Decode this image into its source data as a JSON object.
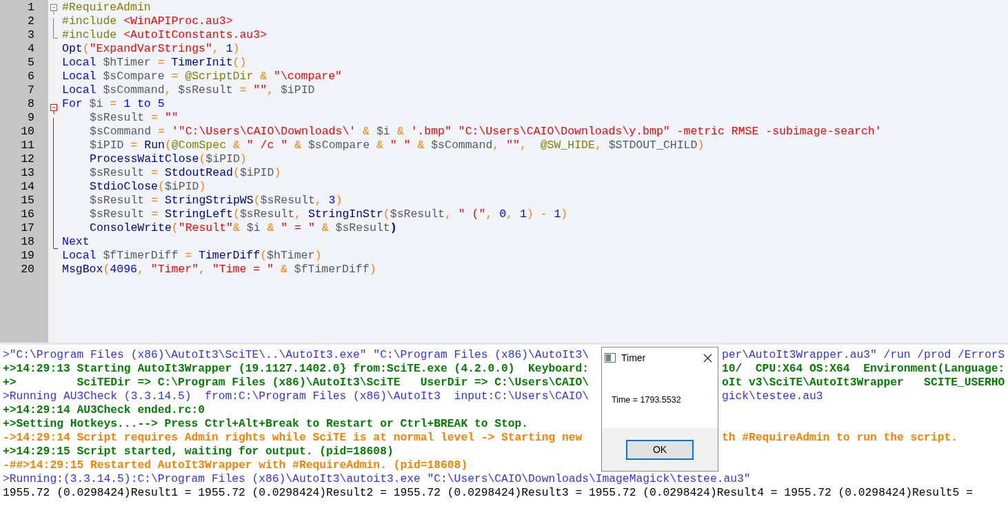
{
  "editor": {
    "lines": [
      {
        "number": "1",
        "kind": "fold-start",
        "fold_highlight": false,
        "indented": false,
        "tokens": [
          {
            "t": "#RequireAdmin",
            "kind": "dir"
          }
        ]
      },
      {
        "number": "2",
        "kind": "fold-mid",
        "fold_highlight": false,
        "indented": false,
        "tokens": [
          {
            "t": "#include ",
            "kind": "dir"
          },
          {
            "t": "<WinAPIProc.au3>",
            "kind": "str"
          }
        ]
      },
      {
        "number": "3",
        "kind": "fold-end",
        "fold_highlight": false,
        "indented": false,
        "tokens": [
          {
            "t": "#include ",
            "kind": "dir"
          },
          {
            "t": "<AutoItConstants.au3>",
            "kind": "str"
          }
        ]
      },
      {
        "number": "4",
        "indented": false,
        "tokens": [
          {
            "t": "Opt",
            "kind": "fn"
          },
          {
            "t": "(",
            "kind": "op"
          },
          {
            "t": "\"ExpandVarStrings\"",
            "kind": "str"
          },
          {
            "t": ", ",
            "kind": "op"
          },
          {
            "t": "1",
            "kind": "num"
          },
          {
            "t": ")",
            "kind": "op"
          }
        ]
      },
      {
        "number": "5",
        "indented": false,
        "tokens": [
          {
            "t": "Local ",
            "kind": "kw"
          },
          {
            "t": "$hTimer ",
            "kind": "var"
          },
          {
            "t": "= ",
            "kind": "op"
          },
          {
            "t": "TimerInit",
            "kind": "fn"
          },
          {
            "t": "()",
            "kind": "op"
          }
        ]
      },
      {
        "number": "6",
        "indented": false,
        "tokens": [
          {
            "t": "Local ",
            "kind": "kw"
          },
          {
            "t": "$sCompare ",
            "kind": "var"
          },
          {
            "t": "= ",
            "kind": "op"
          },
          {
            "t": "@ScriptDir ",
            "kind": "macro"
          },
          {
            "t": "& ",
            "kind": "op"
          },
          {
            "t": "\"\\compare\"",
            "kind": "str"
          }
        ]
      },
      {
        "number": "7",
        "indented": false,
        "tokens": [
          {
            "t": "Local ",
            "kind": "kw"
          },
          {
            "t": "$sCommand",
            "kind": "var"
          },
          {
            "t": ", ",
            "kind": "op"
          },
          {
            "t": "$sResult ",
            "kind": "var"
          },
          {
            "t": "= ",
            "kind": "op"
          },
          {
            "t": "\"\"",
            "kind": "str"
          },
          {
            "t": ", ",
            "kind": "op"
          },
          {
            "t": "$iPID",
            "kind": "var"
          }
        ]
      },
      {
        "number": "8",
        "kind": "fold-start",
        "fold_highlight": true,
        "indented": false,
        "tokens": [
          {
            "t": "For ",
            "kind": "kw"
          },
          {
            "t": "$i ",
            "kind": "var"
          },
          {
            "t": "= ",
            "kind": "op"
          },
          {
            "t": "1 ",
            "kind": "num"
          },
          {
            "t": "to ",
            "kind": "kw"
          },
          {
            "t": "5",
            "kind": "num"
          }
        ]
      },
      {
        "number": "9",
        "kind": "fold-mid",
        "fold_highlight": true,
        "indented": true,
        "tokens": [
          {
            "t": "$sResult ",
            "kind": "var"
          },
          {
            "t": "= ",
            "kind": "op"
          },
          {
            "t": "\"\"",
            "kind": "str"
          }
        ]
      },
      {
        "number": "10",
        "kind": "fold-mid",
        "fold_highlight": true,
        "indented": true,
        "tokens": [
          {
            "t": "$sCommand ",
            "kind": "var"
          },
          {
            "t": "= ",
            "kind": "op"
          },
          {
            "t": "'\"C:\\Users\\CAIO\\Downloads\\'",
            "kind": "str"
          },
          {
            "t": " & ",
            "kind": "op"
          },
          {
            "t": "$i ",
            "kind": "var"
          },
          {
            "t": "& ",
            "kind": "op"
          },
          {
            "t": "'.bmp\" \"C:\\Users\\CAIO\\Downloads\\y.bmp\" -metric RMSE -subimage-search'",
            "kind": "str"
          }
        ]
      },
      {
        "number": "11",
        "kind": "fold-mid",
        "fold_highlight": true,
        "indented": true,
        "tokens": [
          {
            "t": "$iPID ",
            "kind": "var"
          },
          {
            "t": "= ",
            "kind": "op"
          },
          {
            "t": "Run",
            "kind": "fn"
          },
          {
            "t": "(",
            "kind": "op"
          },
          {
            "t": "@ComSpec ",
            "kind": "macro"
          },
          {
            "t": "& ",
            "kind": "op"
          },
          {
            "t": "\" /c \" ",
            "kind": "str"
          },
          {
            "t": "& ",
            "kind": "op"
          },
          {
            "t": "$sCompare ",
            "kind": "var"
          },
          {
            "t": "& ",
            "kind": "op"
          },
          {
            "t": "\" \" ",
            "kind": "str"
          },
          {
            "t": "& ",
            "kind": "op"
          },
          {
            "t": "$sCommand",
            "kind": "var"
          },
          {
            "t": ", ",
            "kind": "op"
          },
          {
            "t": "\"\"",
            "kind": "str"
          },
          {
            "t": ",  ",
            "kind": "op"
          },
          {
            "t": "@SW_HIDE",
            "kind": "macro"
          },
          {
            "t": ", ",
            "kind": "op"
          },
          {
            "t": "$STDOUT_CHILD",
            "kind": "var"
          },
          {
            "t": ")",
            "kind": "op"
          }
        ]
      },
      {
        "number": "12",
        "kind": "fold-mid",
        "fold_highlight": true,
        "indented": true,
        "tokens": [
          {
            "t": "ProcessWaitClose",
            "kind": "fn"
          },
          {
            "t": "(",
            "kind": "op"
          },
          {
            "t": "$iPID",
            "kind": "var"
          },
          {
            "t": ")",
            "kind": "op"
          }
        ]
      },
      {
        "number": "13",
        "kind": "fold-mid",
        "fold_highlight": true,
        "indented": true,
        "tokens": [
          {
            "t": "$sResult ",
            "kind": "var"
          },
          {
            "t": "= ",
            "kind": "op"
          },
          {
            "t": "StdoutRead",
            "kind": "fn"
          },
          {
            "t": "(",
            "kind": "op"
          },
          {
            "t": "$iPID",
            "kind": "var"
          },
          {
            "t": ")",
            "kind": "op"
          }
        ]
      },
      {
        "number": "14",
        "kind": "fold-mid",
        "fold_highlight": true,
        "indented": true,
        "tokens": [
          {
            "t": "StdioClose",
            "kind": "fn"
          },
          {
            "t": "(",
            "kind": "op"
          },
          {
            "t": "$iPID",
            "kind": "var"
          },
          {
            "t": ")",
            "kind": "op"
          }
        ]
      },
      {
        "number": "15",
        "kind": "fold-mid",
        "fold_highlight": true,
        "indented": true,
        "tokens": [
          {
            "t": "$sResult ",
            "kind": "var"
          },
          {
            "t": "= ",
            "kind": "op"
          },
          {
            "t": "StringStripWS",
            "kind": "fn"
          },
          {
            "t": "(",
            "kind": "op"
          },
          {
            "t": "$sResult",
            "kind": "var"
          },
          {
            "t": ", ",
            "kind": "op"
          },
          {
            "t": "3",
            "kind": "num"
          },
          {
            "t": ")",
            "kind": "op"
          }
        ]
      },
      {
        "number": "16",
        "kind": "fold-mid",
        "fold_highlight": true,
        "indented": true,
        "tokens": [
          {
            "t": "$sResult ",
            "kind": "var"
          },
          {
            "t": "= ",
            "kind": "op"
          },
          {
            "t": "StringLeft",
            "kind": "fn"
          },
          {
            "t": "(",
            "kind": "op"
          },
          {
            "t": "$sResult",
            "kind": "var"
          },
          {
            "t": ", ",
            "kind": "op"
          },
          {
            "t": "StringInStr",
            "kind": "fn"
          },
          {
            "t": "(",
            "kind": "op"
          },
          {
            "t": "$sResult",
            "kind": "var"
          },
          {
            "t": ", ",
            "kind": "op"
          },
          {
            "t": "\" (\"",
            "kind": "str"
          },
          {
            "t": ", ",
            "kind": "op"
          },
          {
            "t": "0",
            "kind": "num"
          },
          {
            "t": ", ",
            "kind": "op"
          },
          {
            "t": "1",
            "kind": "num"
          },
          {
            "t": ") - ",
            "kind": "op"
          },
          {
            "t": "1",
            "kind": "num"
          },
          {
            "t": ")",
            "kind": "op"
          }
        ]
      },
      {
        "number": "17",
        "kind": "fold-mid",
        "fold_highlight": true,
        "indented": true,
        "tokens": [
          {
            "t": "ConsoleWrite",
            "kind": "fn"
          },
          {
            "t": "(",
            "kind": "op"
          },
          {
            "t": "\"Result\"",
            "kind": "str"
          },
          {
            "t": "& ",
            "kind": "op"
          },
          {
            "t": "$i ",
            "kind": "var"
          },
          {
            "t": "& ",
            "kind": "op"
          },
          {
            "t": "\" = \" ",
            "kind": "str"
          },
          {
            "t": "& ",
            "kind": "op"
          },
          {
            "t": "$sResult",
            "kind": "var"
          },
          {
            "t": ")",
            "kind": "fn"
          }
        ]
      },
      {
        "number": "18",
        "kind": "fold-end",
        "fold_highlight": true,
        "indented": false,
        "tokens": [
          {
            "t": "Next",
            "kind": "kw"
          }
        ]
      },
      {
        "number": "19",
        "indented": false,
        "tokens": [
          {
            "t": "Local ",
            "kind": "kw"
          },
          {
            "t": "$fTimerDiff ",
            "kind": "var"
          },
          {
            "t": "= ",
            "kind": "op"
          },
          {
            "t": "TimerDiff",
            "kind": "fn"
          },
          {
            "t": "(",
            "kind": "op"
          },
          {
            "t": "$hTimer",
            "kind": "var"
          },
          {
            "t": ")",
            "kind": "op"
          }
        ]
      },
      {
        "number": "20",
        "indented": false,
        "tokens": [
          {
            "t": "MsgBox",
            "kind": "fn"
          },
          {
            "t": "(",
            "kind": "op"
          },
          {
            "t": "4096",
            "kind": "num"
          },
          {
            "t": ", ",
            "kind": "op"
          },
          {
            "t": "\"Timer\"",
            "kind": "str"
          },
          {
            "t": ", ",
            "kind": "op"
          },
          {
            "t": "\"Time = \" ",
            "kind": "str"
          },
          {
            "t": "& ",
            "kind": "op"
          },
          {
            "t": "$fTimerDiff",
            "kind": "var"
          },
          {
            "t": ")",
            "kind": "op"
          }
        ]
      }
    ]
  },
  "output": {
    "lines": [
      {
        "kind": "info",
        "text": ">\"C:\\Program Files (x86)\\AutoIt3\\SciTE\\..\\AutoIt3.exe\" \"C:\\Program Files (x86)\\AutoIt3\\",
        "text_right": "per\\AutoIt3Wrapper.au3\" /run /prod /ErrorS"
      },
      {
        "kind": "success",
        "text": "+>14:29:13 Starting AutoIt3Wrapper (19.1127.1402.0} from:SciTE.exe (4.2.0.0)  Keyboard:",
        "text_right": "10/  CPU:X64 OS:X64  Environment(Language:"
      },
      {
        "kind": "success",
        "text": "+>         SciTEDir => C:\\Program Files (x86)\\AutoIt3\\SciTE   UserDir => C:\\Users\\CAIO\\",
        "text_right": "oIt v3\\SciTE\\AutoIt3Wrapper   SCITE_USERHO"
      },
      {
        "kind": "info",
        "text": ">Running AU3Check (3.3.14.5)  from:C:\\Program Files (x86)\\AutoIt3  input:C:\\Users\\CAIO\\",
        "text_right": "gick\\testee.au3"
      },
      {
        "kind": "success",
        "text": "+>14:29:14 AU3Check ended.rc:0"
      },
      {
        "kind": "success",
        "text": "+>Setting Hotkeys...--> Press Ctrl+Alt+Break to Restart or Ctrl+BREAK to Stop."
      },
      {
        "kind": "warning",
        "text": "->14:29:14 Script requires Admin rights while SciTE is at normal level -> Starting new",
        "text_right": "th #RequireAdmin to run the script."
      },
      {
        "kind": "success",
        "text": "+>14:29:15 Script started, waiting for output. (pid=18608)"
      },
      {
        "kind": "warning",
        "text": "-##>14:29:15 Restarted AutoIt3Wrapper with #RequireAdmin. (pid=18608)"
      },
      {
        "kind": "info",
        "text": ">Running:(3.3.14.5):C:\\Program Files (x86)\\AutoIt3\\autoit3.exe \"C:\\Users\\CAIO\\Downloads\\ImageMagick\\testee.au3\""
      },
      {
        "kind": "plain",
        "text": "1955.72 (0.0298424)Result1 = 1955.72 (0.0298424)Result2 = 1955.72 (0.0298424)Result3 = 1955.72 (0.0298424)Result4 = 1955.72 (0.0298424)Result5 ="
      }
    ]
  },
  "dialog": {
    "title": "Timer",
    "message": "Time = 1793.5532",
    "button": "OK"
  }
}
